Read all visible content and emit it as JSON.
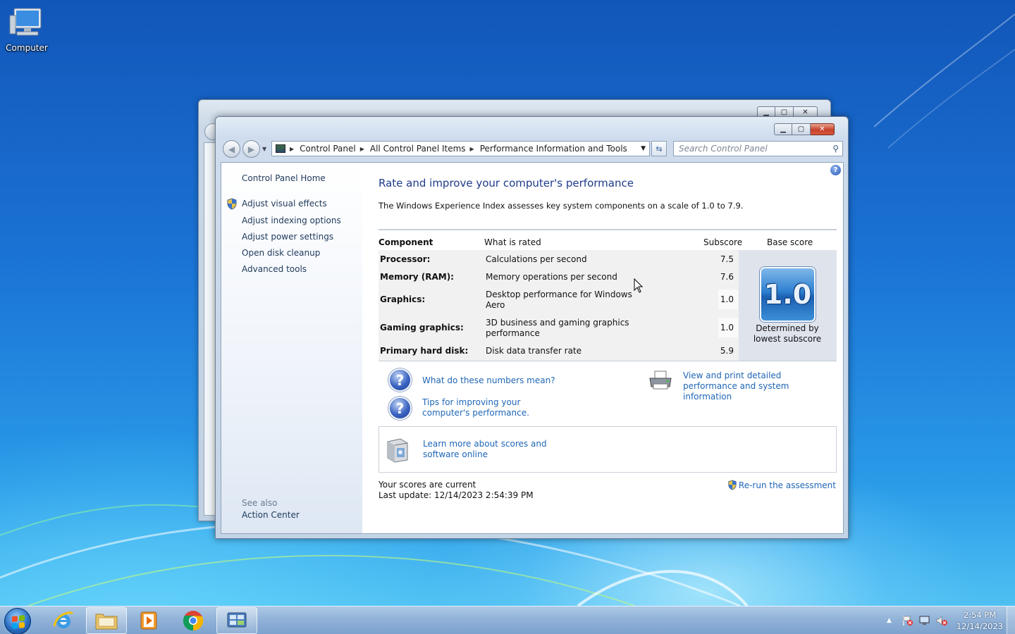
{
  "desktop": {
    "icons": [
      {
        "label": "Computer",
        "icon": "computer-icon"
      }
    ]
  },
  "window": {
    "address": {
      "segments": [
        "Control Panel",
        "All Control Panel Items",
        "Performance Information and Tools"
      ]
    },
    "search": {
      "placeholder": "Search Control Panel"
    }
  },
  "sidebar": {
    "home": "Control Panel Home",
    "tasks": [
      "Adjust visual effects",
      "Adjust indexing options",
      "Adjust power settings",
      "Open disk cleanup",
      "Advanced tools"
    ],
    "see_also_heading": "See also",
    "see_also": [
      "Action Center"
    ]
  },
  "content": {
    "title": "Rate and improve your computer's performance",
    "description": "The Windows Experience Index assesses key system components on a scale of 1.0 to 7.9.",
    "table": {
      "headers": [
        "Component",
        "What is rated",
        "Subscore",
        "Base score"
      ],
      "rows": [
        {
          "component": "Processor:",
          "rated": "Calculations per second",
          "subscore": "7.5"
        },
        {
          "component": "Memory (RAM):",
          "rated": "Memory operations per second",
          "subscore": "7.6"
        },
        {
          "component": "Graphics:",
          "rated": "Desktop performance for Windows Aero",
          "subscore": "1.0"
        },
        {
          "component": "Gaming graphics:",
          "rated": "3D business and gaming graphics performance",
          "subscore": "1.0"
        },
        {
          "component": "Primary hard disk:",
          "rated": "Disk data transfer rate",
          "subscore": "5.9"
        }
      ],
      "base_score": "1.0",
      "base_note": "Determined by lowest subscore"
    },
    "links": {
      "numbers": "What do these numbers mean?",
      "tips": "Tips for improving your computer's performance.",
      "print": "View and print detailed performance and system information",
      "learn": "Learn more about scores and software online"
    },
    "status": {
      "current": "Your scores are current",
      "last_update": "Last update: 12/14/2023 2:54:39 PM"
    },
    "rerun": "Re-run the assessment"
  },
  "taskbar": {
    "clock_time": "2:54 PM",
    "clock_date": "12/14/2023"
  },
  "colors": {
    "link": "#1f66b5",
    "title": "#1e3b8a",
    "close_button": "#c6412b"
  }
}
